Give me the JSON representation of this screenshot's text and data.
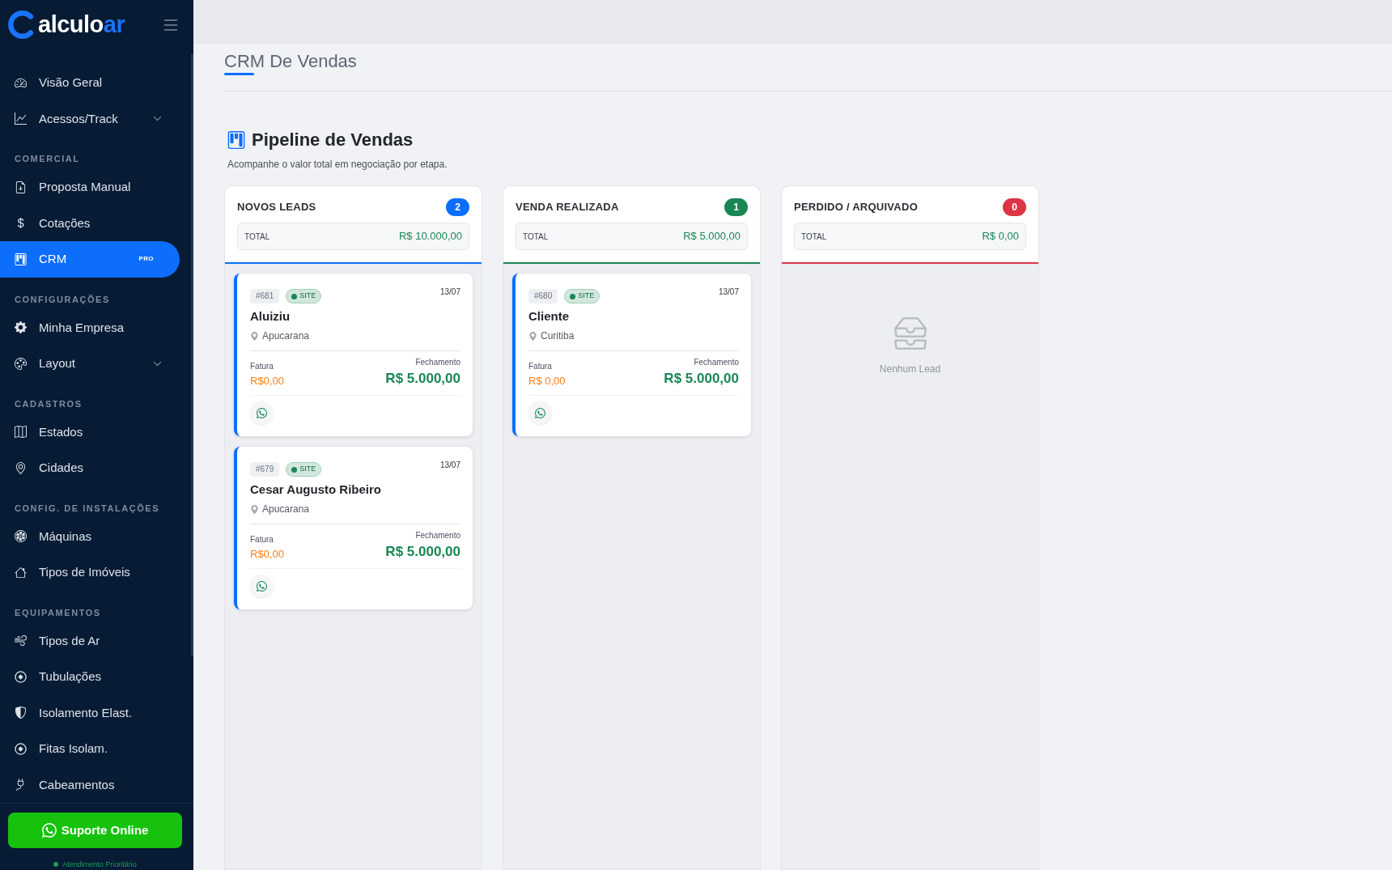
{
  "sidebar": {
    "logo": {
      "text": "alculo",
      "accent_text": "ar"
    },
    "nav": [
      {
        "kind": "item",
        "label": "Visão Geral",
        "selected": false,
        "expandable": false
      },
      {
        "kind": "item",
        "label": "Acessos/Track",
        "selected": false,
        "expandable": true
      },
      {
        "kind": "heading",
        "label": "COMERCIAL"
      },
      {
        "kind": "item",
        "label": "Proposta Manual",
        "selected": false,
        "expandable": false
      },
      {
        "kind": "item",
        "label": "Cotações",
        "selected": false,
        "expandable": false
      },
      {
        "kind": "item",
        "label": "CRM",
        "selected": true,
        "expandable": false,
        "badge": "PRO"
      },
      {
        "kind": "heading",
        "label": "CONFIGURAÇÕES"
      },
      {
        "kind": "item",
        "label": "Minha Empresa",
        "selected": false,
        "expandable": false
      },
      {
        "kind": "item",
        "label": "Layout",
        "selected": false,
        "expandable": true
      },
      {
        "kind": "heading",
        "label": "CADASTROS"
      },
      {
        "kind": "item",
        "label": "Estados",
        "selected": false,
        "expandable": false
      },
      {
        "kind": "item",
        "label": "Cidades",
        "selected": false,
        "expandable": false
      },
      {
        "kind": "heading",
        "label": "CONFIG. DE INSTALAÇÕES"
      },
      {
        "kind": "item",
        "label": "Máquinas",
        "selected": false,
        "expandable": false
      },
      {
        "kind": "item",
        "label": "Tipos de Imóveis",
        "selected": false,
        "expandable": false
      },
      {
        "kind": "heading",
        "label": "EQUIPAMENTOS"
      },
      {
        "kind": "item",
        "label": "Tipos de Ar",
        "selected": false,
        "expandable": false
      },
      {
        "kind": "item",
        "label": "Tubulações",
        "selected": false,
        "expandable": false
      },
      {
        "kind": "item",
        "label": "Isolamento Elast.",
        "selected": false,
        "expandable": false
      },
      {
        "kind": "item",
        "label": "Fitas Isolam.",
        "selected": false,
        "expandable": false
      },
      {
        "kind": "item",
        "label": "Cabeamentos",
        "selected": false,
        "expandable": false
      }
    ],
    "support_button": "Suporte Online",
    "support_status": {
      "text": "Atendimento Prioritário",
      "online": true
    }
  },
  "header": {
    "title": "CRM De Vendas"
  },
  "pipeline": {
    "title": "Pipeline de Vendas",
    "subtitle": "Acompanhe o valor total em negociação por etapa."
  },
  "columns": [
    {
      "title": "NOVOS LEADS",
      "count": "2",
      "color": "#0d6efd",
      "total_label": "TOTAL",
      "total": "R$ 10.000,00",
      "cards": [
        {
          "id": "#681",
          "source": "SITE",
          "date": "13/07",
          "name": "Aluiziu",
          "city": "Apucarana",
          "invoice_label": "Fatura",
          "invoice": "R$0,00",
          "closing_label": "Fechamento",
          "closing": "R$ 5.000,00"
        },
        {
          "id": "#679",
          "source": "SITE",
          "date": "13/07",
          "name": "Cesar Augusto Ribeiro",
          "city": "Apucarana",
          "invoice_label": "Fatura",
          "invoice": "R$0,00",
          "closing_label": "Fechamento",
          "closing": "R$ 5.000,00"
        }
      ]
    },
    {
      "title": "VENDA REALIZADA",
      "count": "1",
      "color": "#198754",
      "total_label": "TOTAL",
      "total": "R$ 5.000,00",
      "cards": [
        {
          "id": "#680",
          "source": "SITE",
          "date": "13/07",
          "name": "Cliente",
          "city": "Curitiba",
          "invoice_label": "Fatura",
          "invoice": "R$ 0,00",
          "closing_label": "Fechamento",
          "closing": "R$ 5.000,00"
        }
      ]
    },
    {
      "title": "PERDIDO / ARQUIVADO",
      "count": "0",
      "color": "#dc3545",
      "total_label": "TOTAL",
      "total": "R$ 0,00",
      "empty_text": "Nenhum Lead"
    }
  ]
}
